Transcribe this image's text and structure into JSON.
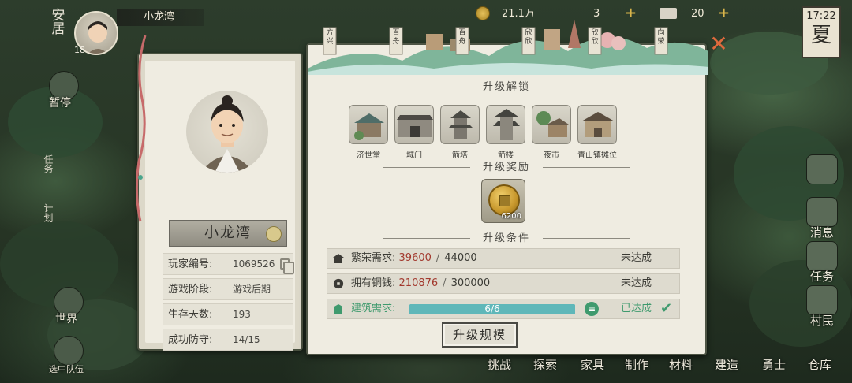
{
  "top_bar": {
    "location": "安居",
    "avatar_level": "18",
    "village_name": "小龙湾",
    "coins": "21.1万",
    "resource_two": "3",
    "resource_three": "20",
    "clock_time": "17:22",
    "season": "夏"
  },
  "left_menu": {
    "pause": "暂停",
    "task": "任务",
    "plan": "计划",
    "world": "世界",
    "selected_team": "选中队伍"
  },
  "right_menu": {
    "message": "消息",
    "task": "任务",
    "villager": "村民"
  },
  "bottom_menu": [
    "挑战",
    "探索",
    "家具",
    "制作",
    "材料",
    "建造",
    "勇士",
    "仓库"
  ],
  "top_art_labels": [
    "方兴",
    "百舟",
    "百舟",
    "欣欣",
    "欣欣",
    "向荣"
  ],
  "profile": {
    "name": "小龙湾",
    "rows": [
      {
        "key": "玩家编号:",
        "value": "1069526"
      },
      {
        "key": "游戏阶段:",
        "value": "游戏后期"
      },
      {
        "key": "生存天数:",
        "value": "193"
      },
      {
        "key": "成功防守:",
        "value": "14/15"
      }
    ]
  },
  "upgrade": {
    "unlock_title": "升级解锁",
    "unlock_items": [
      "济世堂",
      "城门",
      "箭塔",
      "箭楼",
      "夜市",
      "青山镇摊位"
    ],
    "reward_title": "升级奖励",
    "reward_amount": "6200",
    "condition_title": "升级条件",
    "conditions": [
      {
        "label": "繁荣需求:",
        "current": "39600",
        "required": "44000",
        "status": "未达成"
      },
      {
        "label": "拥有铜钱:",
        "current": "210876",
        "required": "300000",
        "status": "未达成"
      }
    ],
    "building": {
      "label": "建筑需求:",
      "progress_text": "6/6",
      "progress": 1.0,
      "status": "已达成"
    },
    "button_label": "升级规模"
  },
  "colors": {
    "accent_green": "#3f9a6e",
    "unmet_red": "#a33a2f",
    "progress_teal": "#5fb7b9",
    "close_orange": "#e06a3d"
  }
}
